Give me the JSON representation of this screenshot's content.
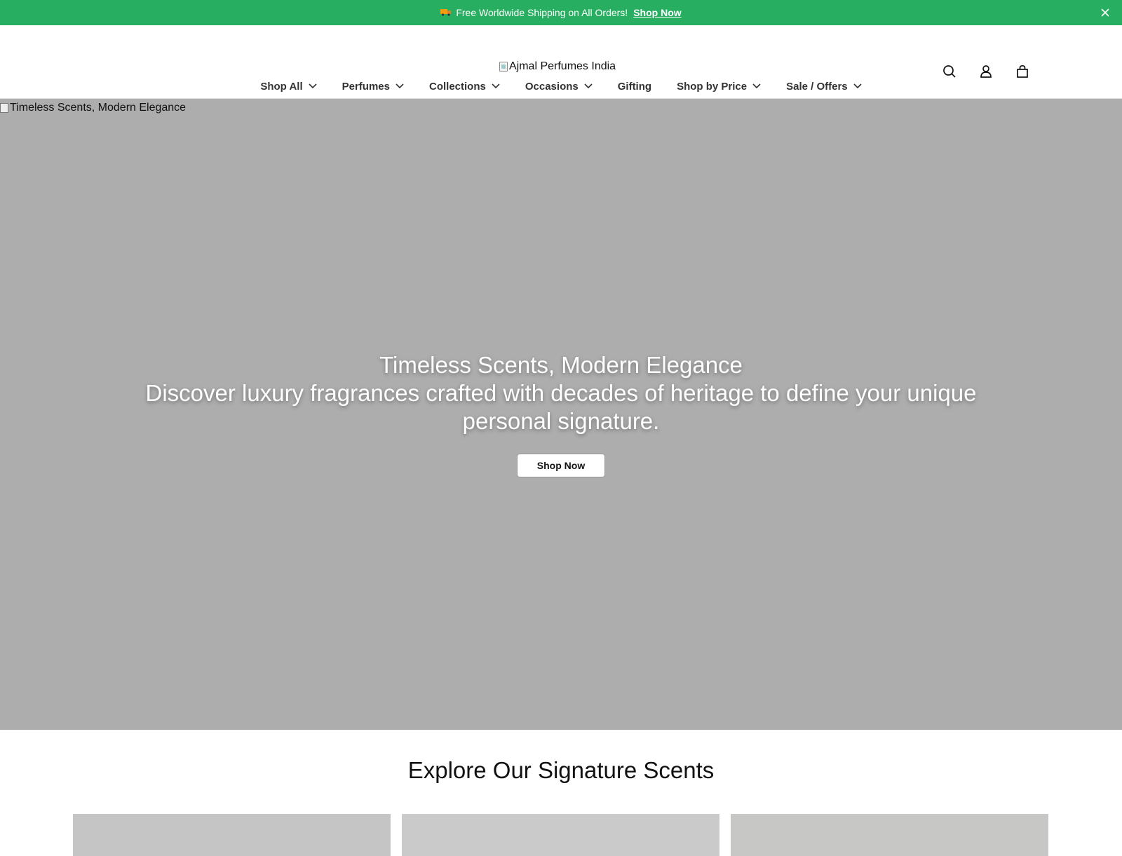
{
  "announcement": {
    "text": "Free Worldwide Shipping on All Orders!",
    "link": "Shop Now",
    "bg_color": "#27ae60"
  },
  "header": {
    "logo_alt": "Ajmal Perfumes India",
    "icons": [
      "search-icon",
      "account-icon",
      "cart-icon"
    ]
  },
  "nav": {
    "items": [
      {
        "label": "Shop All"
      },
      {
        "label": "Perfumes"
      },
      {
        "label": "Collections"
      },
      {
        "label": "Occasions"
      },
      {
        "label": "Gifting"
      },
      {
        "label": "Shop by Price"
      },
      {
        "label": "Sale / Offers"
      }
    ]
  },
  "hero": {
    "image_alt": "Timeless Scents, Modern Elegance",
    "title": "Timeless Scents, Modern Elegance",
    "subtitle": "Discover luxury fragrances crafted with decades of heritage to define your unique personal signature.",
    "button": "Shop Now"
  },
  "signature": {
    "title": "Explore Our Signature Scents",
    "card_colors": [
      "#c5c5c5",
      "#cacaca",
      "#c7c7c5"
    ]
  }
}
